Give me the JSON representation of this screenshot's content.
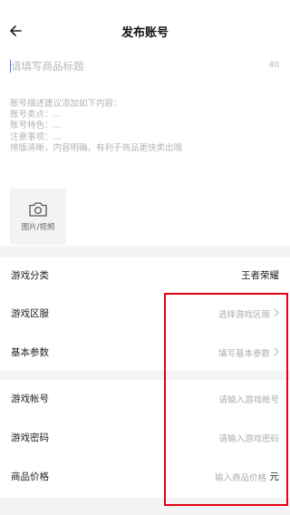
{
  "header": {
    "title": "发布账号",
    "back_icon": "arrow-left-icon"
  },
  "title_input": {
    "placeholder": "请填写商品标题",
    "value": "",
    "counter": "40"
  },
  "description": {
    "lines": [
      "账号描述建议添加如下内容：",
      "账号卖点：...",
      "账号特色：...",
      "注意事项：...",
      "排版清晰，内容明确，有利于商品更快卖出哦"
    ]
  },
  "upload": {
    "label": "图片/视频",
    "icon": "camera-icon"
  },
  "group1": {
    "rows": [
      {
        "label": "游戏分类",
        "value": "王者荣耀"
      },
      {
        "label": "游戏区服",
        "hint": "选择游戏区服"
      },
      {
        "label": "基本参数",
        "hint": "填写基本参数"
      }
    ]
  },
  "group2": {
    "rows": [
      {
        "label": "游戏帐号",
        "placeholder": "请输入游戏帐号"
      },
      {
        "label": "游戏密码",
        "placeholder": "请输入游戏密码"
      },
      {
        "label": "商品价格",
        "placeholder": "输入商品价格",
        "unit": "元"
      }
    ]
  },
  "colors": {
    "highlight": "#e60012",
    "cursor": "#3b7cff",
    "background": "#f4f4f6"
  }
}
